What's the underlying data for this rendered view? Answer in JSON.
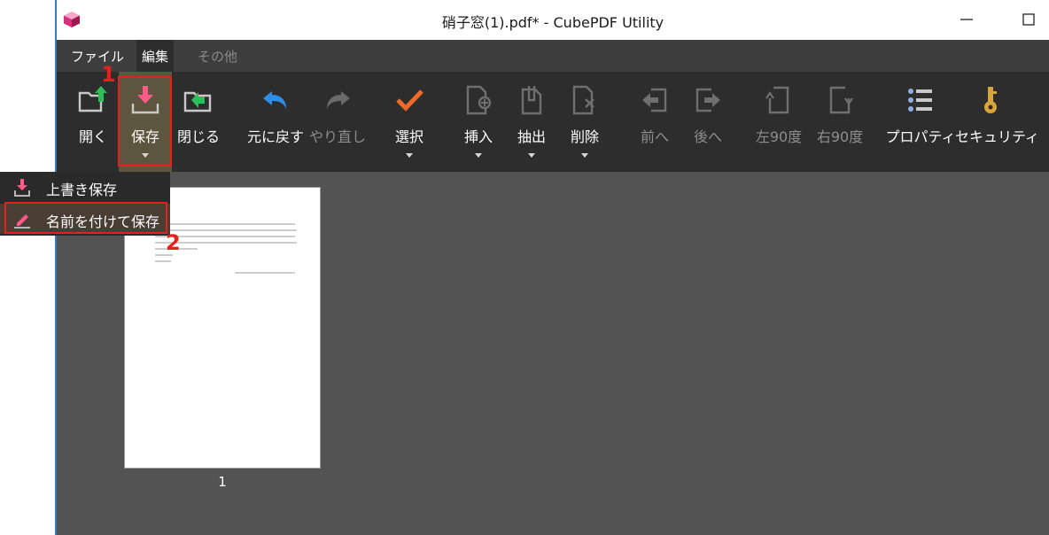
{
  "window": {
    "title": "硝子窓(1).pdf* - CubePDF Utility",
    "minimize_icon": "minimize-icon",
    "maximize_icon": "maximize-icon"
  },
  "tabs": [
    {
      "label": "ファイル",
      "state": "normal"
    },
    {
      "label": "編集",
      "state": "active"
    },
    {
      "label": "その他",
      "state": "disabled"
    }
  ],
  "toolbar": {
    "open": {
      "label": "開く",
      "icon": "open-folder-icon"
    },
    "save": {
      "label": "保存",
      "icon": "save-icon"
    },
    "close": {
      "label": "閉じる",
      "icon": "close-file-icon"
    },
    "undo": {
      "label": "元に戻す",
      "icon": "undo-icon"
    },
    "redo": {
      "label": "やり直し",
      "icon": "redo-icon"
    },
    "select": {
      "label": "選択",
      "icon": "checkmark-icon"
    },
    "insert": {
      "label": "挿入",
      "icon": "insert-page-icon"
    },
    "extract": {
      "label": "抽出",
      "icon": "extract-icon"
    },
    "delete": {
      "label": "削除",
      "icon": "delete-page-icon"
    },
    "prev": {
      "label": "前へ",
      "icon": "move-previous-icon"
    },
    "next": {
      "label": "後へ",
      "icon": "move-next-icon"
    },
    "rotate_left": {
      "label": "左90度",
      "icon": "rotate-left-icon"
    },
    "rotate_right": {
      "label": "右90度",
      "icon": "rotate-right-icon"
    },
    "properties": {
      "label": "プロパティ",
      "icon": "properties-icon"
    },
    "security": {
      "label": "セキュリティ",
      "icon": "key-icon"
    }
  },
  "save_menu": {
    "overwrite": "上書き保存",
    "save_as": "名前を付けて保存"
  },
  "annotations": {
    "step1": "1",
    "step2": "2"
  },
  "pages": [
    {
      "number": "1"
    }
  ],
  "colors": {
    "highlight": "#e8201a",
    "toolbar_bg": "#2d2d2d",
    "canvas_bg": "#535353",
    "window_border": "#2b78d0"
  }
}
